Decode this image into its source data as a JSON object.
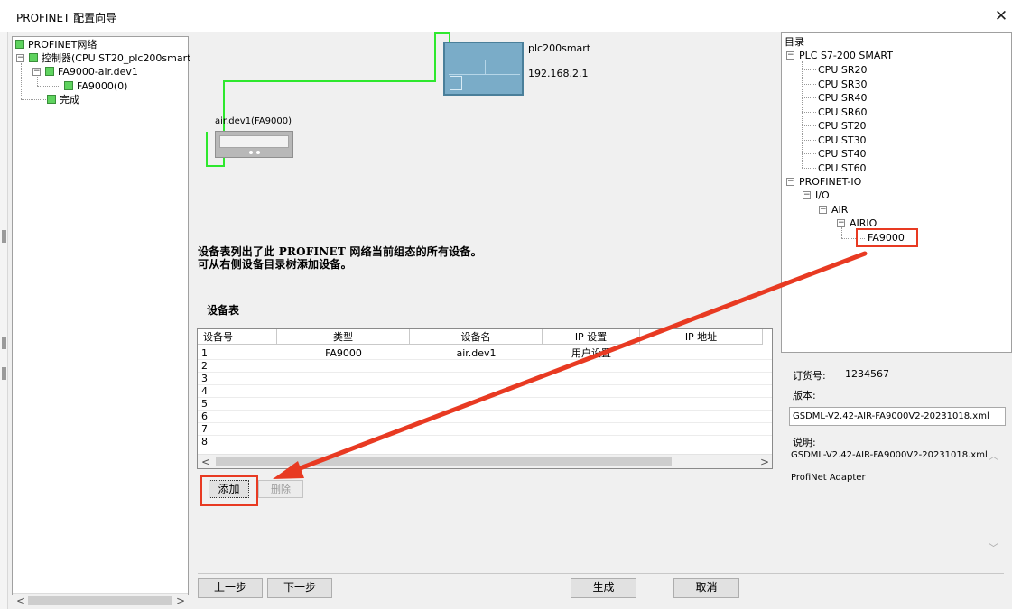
{
  "window": {
    "title": "PROFINET 配置向导",
    "close_glyph": "✕"
  },
  "left_tree": {
    "root": "PROFINET网络",
    "controller": "控制器(CPU ST20_plc200smart)",
    "device": "FA9000-air.dev1",
    "module": "FA9000(0)",
    "done": "完成",
    "scroll_left": "<",
    "scroll_right": ">"
  },
  "network": {
    "plc_name": "plc200smart",
    "plc_ip": "192.168.2.1",
    "device_label": "air.dev1(FA9000)",
    "line_color": "#2ee82e"
  },
  "info": {
    "line1": "设备表列出了此 PROFINET 网络当前组态的所有设备。",
    "line2": "可从右侧设备目录树添加设备。"
  },
  "device_table": {
    "title": "设备表",
    "columns": [
      "设备号",
      "类型",
      "设备名",
      "IP 设置",
      "IP 地址"
    ],
    "rows": [
      {
        "num": "1",
        "type": "FA9000",
        "name": "air.dev1",
        "ip_setting": "用户设置",
        "ip_address": ""
      },
      {
        "num": "2",
        "type": "",
        "name": "",
        "ip_setting": "",
        "ip_address": ""
      },
      {
        "num": "3",
        "type": "",
        "name": "",
        "ip_setting": "",
        "ip_address": ""
      },
      {
        "num": "4",
        "type": "",
        "name": "",
        "ip_setting": "",
        "ip_address": ""
      },
      {
        "num": "5",
        "type": "",
        "name": "",
        "ip_setting": "",
        "ip_address": ""
      },
      {
        "num": "6",
        "type": "",
        "name": "",
        "ip_setting": "",
        "ip_address": ""
      },
      {
        "num": "7",
        "type": "",
        "name": "",
        "ip_setting": "",
        "ip_address": ""
      },
      {
        "num": "8",
        "type": "",
        "name": "",
        "ip_setting": "",
        "ip_address": ""
      }
    ],
    "scroll_left": "<",
    "scroll_right": ">"
  },
  "buttons": {
    "add": "添加",
    "delete": "删除",
    "prev": "上一步",
    "next": "下一步",
    "generate": "生成",
    "cancel": "取消"
  },
  "catalog": {
    "title": "目录",
    "plc_group": "PLC S7-200 SMART",
    "cpus": [
      "CPU SR20",
      "CPU SR30",
      "CPU SR40",
      "CPU SR60",
      "CPU ST20",
      "CPU ST30",
      "CPU ST40",
      "CPU ST60"
    ],
    "profinet_io": "PROFINET-IO",
    "io": "I/O",
    "air": "AIR",
    "airio": "AIRIO",
    "fa9000": "FA9000"
  },
  "details": {
    "order_label": "订货号:",
    "order_value": "1234567",
    "version_label": "版本:",
    "version_value": "GSDML-V2.42-AIR-FA9000V2-20231018.xml",
    "desc_label": "说明:",
    "desc_line1": "GSDML-V2.42-AIR-FA9000V2-20231018.xml",
    "desc_line2": "ProfiNet Adapter",
    "scroll_up": "︿",
    "scroll_down": "﹀"
  },
  "colors": {
    "highlight_red": "#e83a22",
    "status_green": "#5fd35f",
    "plc_blue": "#7aacc8"
  },
  "icons": {
    "tree_node": "green-square-icon",
    "plc": "plc-device-icon",
    "io_device": "io-module-icon",
    "annotation": "red-arrow-annotation"
  }
}
